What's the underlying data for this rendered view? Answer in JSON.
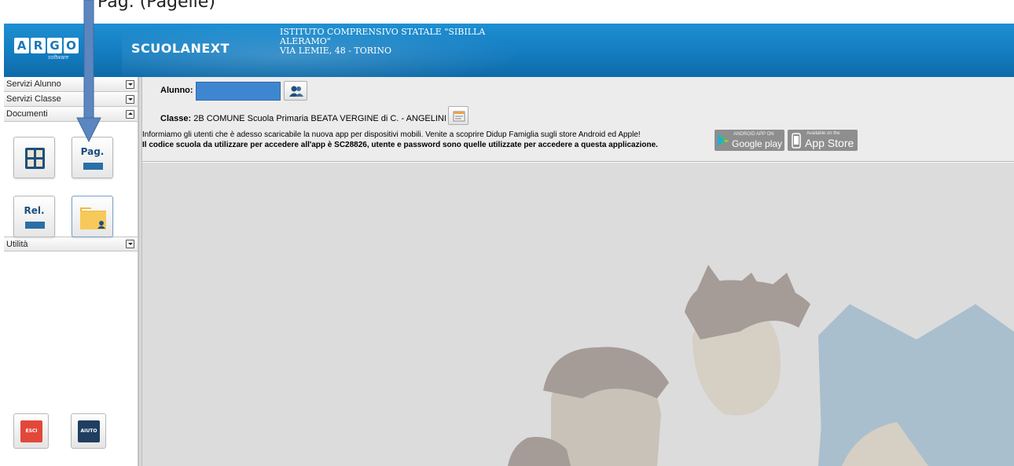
{
  "annotation": {
    "caption": "Pag. (Pagelle)"
  },
  "header": {
    "logo_letters": [
      "A",
      "R",
      "G",
      "O"
    ],
    "logo_sub": "software",
    "product": "SCUOLANEXT",
    "school_line1": "ISTITUTO COMPRENSIVO STATALE \"SIBILLA",
    "school_line2": "ALERAMO\"",
    "school_line3": "VIA LEMIE, 48 - TORINO"
  },
  "sidebar": {
    "sections": [
      {
        "label": "Servizi Alunno",
        "state": "collapsed"
      },
      {
        "label": "Servizi Classe",
        "state": "collapsed"
      },
      {
        "label": "Documenti",
        "state": "expanded"
      }
    ],
    "documents": [
      {
        "label": "",
        "icon": "grid-icon"
      },
      {
        "label": "Pag.",
        "icon": "report-card-icon"
      },
      {
        "label": "Rel.",
        "icon": "report-icon"
      },
      {
        "label": "",
        "icon": "folder-user-icon"
      }
    ],
    "utility": {
      "label": "Utilità",
      "state": "collapsed"
    },
    "bottom": [
      {
        "label": "ESCI",
        "color": "#e2483a"
      },
      {
        "label": "AIUTO",
        "color": "#1f3e60"
      }
    ]
  },
  "info": {
    "alunno_label": "Alunno:",
    "classe_label": "Classe:",
    "classe_value": "2B COMUNE Scuola Primaria BEATA VERGINE di C. - ANGELINI",
    "notice1": "Informiamo gli utenti che è adesso scaricabile la nuova app per dispositivi mobili. Venite a scoprire Didup Famiglia sugli store Android ed Apple!",
    "notice2": "Il codice scuola da utilizzare per accedere all'app è SC28826, utente e password sono quelle utilizzate per accedere a questa applicazione.",
    "gplay_small": "ANDROID APP ON",
    "gplay_big": "Google play",
    "appstore_small": "Available on the",
    "appstore_big": "App Store"
  },
  "colors": {
    "header": "#137cc0",
    "accent": "#3f86d0",
    "illustration_skin": "#d6cfc4",
    "illustration_hair": "#a59c98",
    "illustration_shirt": "#a9bfcd"
  }
}
